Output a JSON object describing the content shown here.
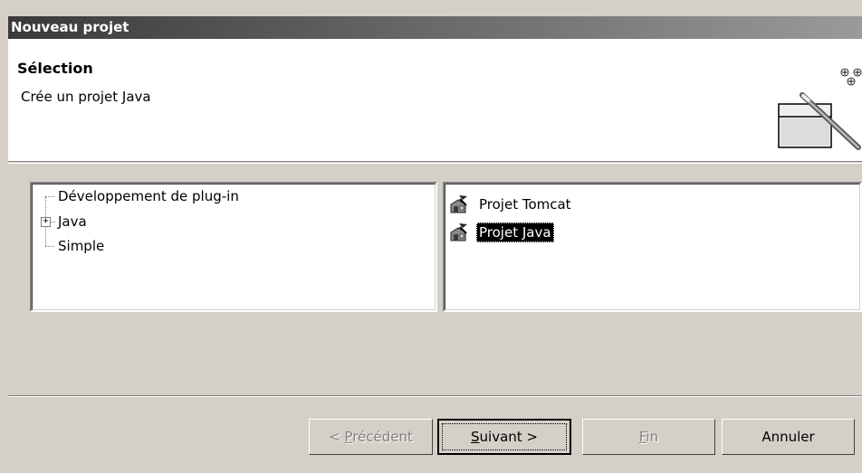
{
  "window": {
    "title": "Nouveau projet"
  },
  "header": {
    "section_title": "Sélection",
    "description": "Crée un projet Java",
    "icon": "new-project-wizard-icon"
  },
  "categories": [
    {
      "label": "Développement de plug-in",
      "expandable": false
    },
    {
      "label": "Java",
      "expandable": true,
      "expander": "+"
    },
    {
      "label": "Simple",
      "expandable": false
    }
  ],
  "wizards": [
    {
      "label": "Projet Tomcat",
      "icon": "tomcat-project-icon",
      "selected": false
    },
    {
      "label": "Projet Java",
      "icon": "java-project-icon",
      "selected": true
    }
  ],
  "buttons": {
    "previous": {
      "prefix": "< ",
      "mnemonic": "P",
      "rest": "récédent",
      "enabled": false
    },
    "next": {
      "mnemonic": "S",
      "rest": "uivant >",
      "enabled": true
    },
    "finish": {
      "mnemonic": "F",
      "rest": "in",
      "enabled": false
    },
    "cancel": {
      "label": "Annuler",
      "enabled": true
    }
  }
}
